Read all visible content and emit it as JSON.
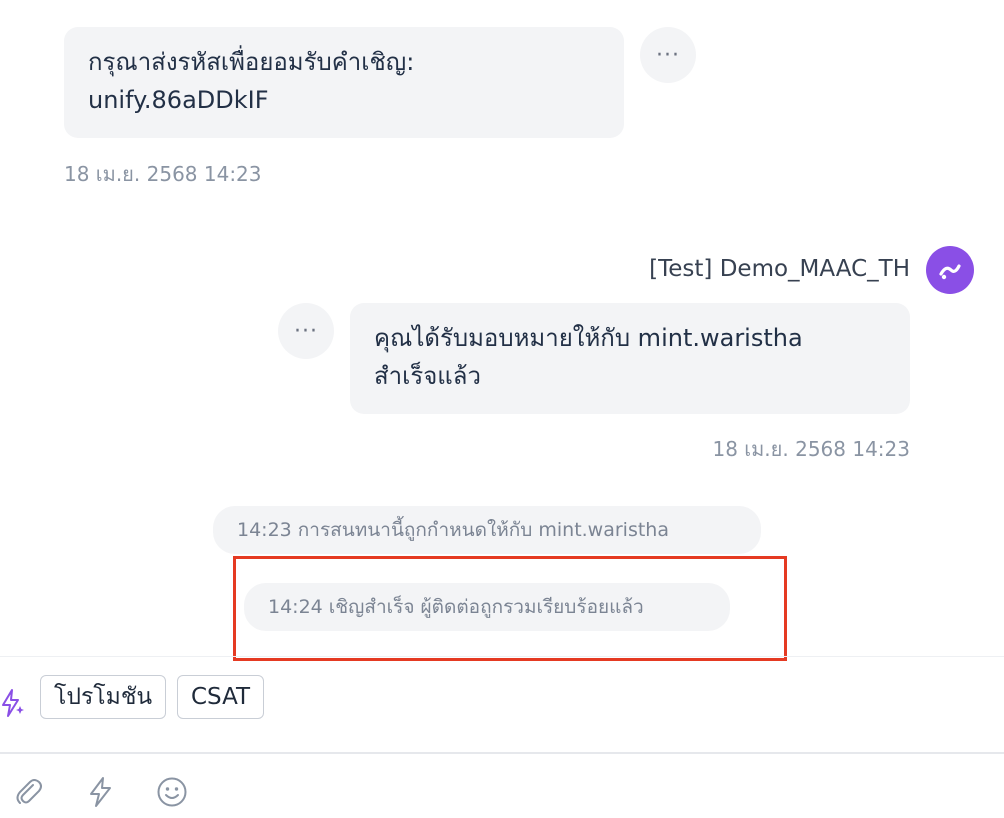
{
  "messages": {
    "incoming": {
      "line1": "กรุณาส่งรหัสเพื่อยอมรับคำเชิญ:",
      "line2": "unify.86aDDkIF",
      "timestamp": "18 เม.ย. 2568 14:23"
    },
    "outgoing": {
      "sender": "[Test] Demo_MAAC_TH",
      "line1": "คุณได้รับมอบหมายให้กับ mint.waristha",
      "line2": "สำเร็จแล้ว",
      "timestamp": "18 เม.ย. 2568 14:23"
    },
    "more_glyph": "···"
  },
  "system_events": [
    "14:23 การสนทนานี้ถูกกำหนดให้กับ  mint.waristha",
    "14:24 เชิญสำเร็จ ผู้ติดต่อถูกรวมเรียบร้อยแล้ว"
  ],
  "quick_replies": {
    "icon": "ai-sparkle-bolt-icon",
    "chips": [
      "โปรโมชัน",
      "CSAT"
    ]
  },
  "toolbar": {
    "icons": [
      "paperclip-icon",
      "lightning-icon",
      "smiley-icon"
    ]
  },
  "colors": {
    "bubble_bg": "#f3f4f6",
    "avatar": "#8a4fe6",
    "highlight": "#e53a22",
    "accent_sparkle": "#8a4fe6"
  }
}
